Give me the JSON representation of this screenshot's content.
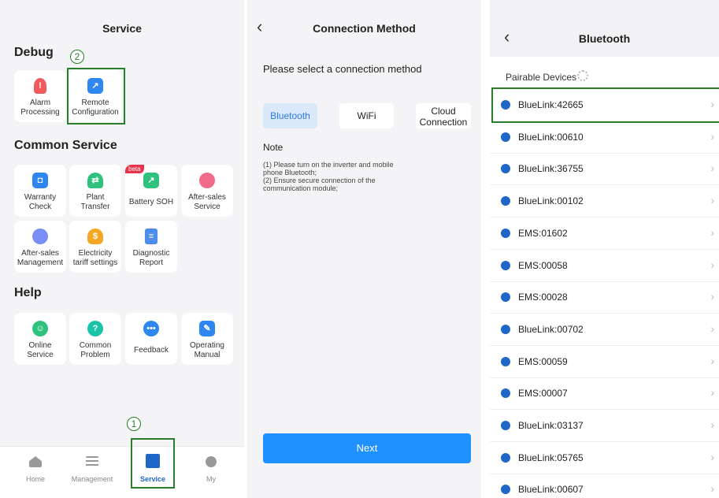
{
  "service": {
    "title": "Service",
    "debug": {
      "title": "Debug",
      "tiles": [
        {
          "label": "Alarm\nProcessing",
          "icon": "alarm-icon",
          "color": "#f05a5a"
        },
        {
          "label": "Remote\nConfiguration",
          "icon": "remote-config-icon",
          "color": "#2e86f0"
        }
      ]
    },
    "common": {
      "title": "Common Service",
      "tiles": [
        {
          "label": "Warranty\nCheck",
          "icon": "warranty-icon"
        },
        {
          "label": "Plant\nTransfer",
          "icon": "plant-transfer-icon"
        },
        {
          "label": "Battery SOH",
          "icon": "battery-soh-icon",
          "badge": "beta"
        },
        {
          "label": "After-sales\nService",
          "icon": "after-sales-icon"
        },
        {
          "label": "After-sales\nManagement",
          "icon": "after-sales-management-icon"
        },
        {
          "label": "Electricity\ntariff settings",
          "icon": "tariff-icon"
        },
        {
          "label": "Diagnostic\nReport",
          "icon": "diagnostic-report-icon"
        }
      ]
    },
    "help": {
      "title": "Help",
      "tiles": [
        {
          "label": "Online\nService",
          "icon": "online-service-icon"
        },
        {
          "label": "Common\nProblem",
          "icon": "common-problem-icon"
        },
        {
          "label": "Feedback",
          "icon": "feedback-icon"
        },
        {
          "label": "Operating\nManual",
          "icon": "operating-manual-icon"
        }
      ]
    },
    "tabs": [
      {
        "label": "Home",
        "icon": "home-icon"
      },
      {
        "label": "Management",
        "icon": "management-icon"
      },
      {
        "label": "Service",
        "icon": "service-icon",
        "active": true
      },
      {
        "label": "My",
        "icon": "my-icon"
      }
    ],
    "step_markers": [
      "1",
      "2"
    ]
  },
  "connection": {
    "title": "Connection Method",
    "prompt": "Please select a connection method",
    "methods": [
      {
        "label": "Bluetooth",
        "selected": true
      },
      {
        "label": "WiFi"
      },
      {
        "label": "Cloud\nConnection"
      }
    ],
    "note_title": "Note",
    "note_lines": [
      "(1) Please turn on the inverter and mobile",
      "phone Bluetooth;",
      "(2) Ensure secure connection of the",
      "communication module;"
    ],
    "next_label": "Next"
  },
  "bluetooth": {
    "title": "Bluetooth",
    "pairable_label": "Pairable Devices",
    "devices": [
      "BlueLink:42665",
      "BlueLink:00610",
      "BlueLink:36755",
      "BlueLink:00102",
      "EMS:01602",
      "EMS:00058",
      "EMS:00028",
      "BlueLink:00702",
      "EMS:00059",
      "EMS:00007",
      "BlueLink:03137",
      "BlueLink:05765",
      "BlueLink:00607"
    ]
  },
  "colors": {
    "accent_blue": "#1e90ff",
    "highlight_green": "#2a7d2a",
    "tab_active": "#1e67c8"
  }
}
